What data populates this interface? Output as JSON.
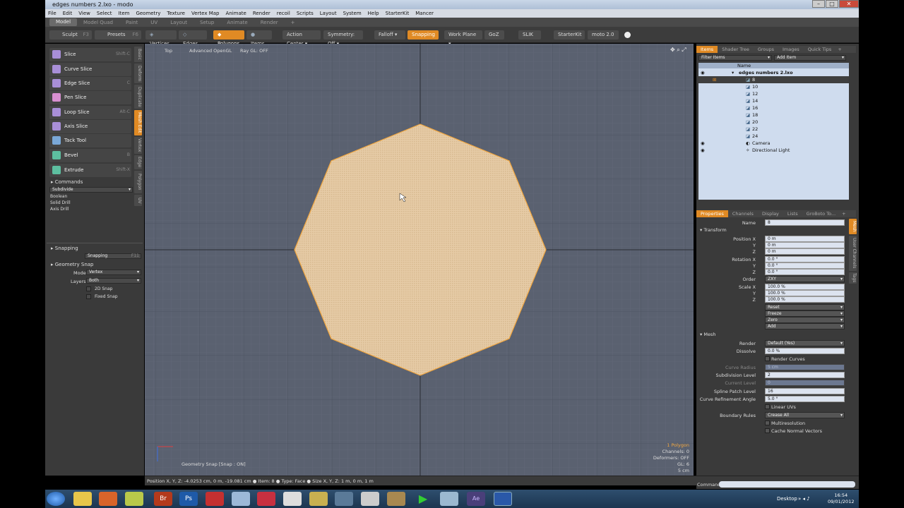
{
  "window": {
    "title": "edges numbers 2.lxo - modo"
  },
  "menu": [
    "File",
    "Edit",
    "View",
    "Select",
    "Item",
    "Geometry",
    "Texture",
    "Vertex Map",
    "Animate",
    "Render",
    "recoil",
    "Scripts",
    "Layout",
    "System",
    "Help",
    "StarterKit",
    "Mancer"
  ],
  "layout_tabs": [
    "Model",
    "Model Quad",
    "Paint",
    "UV",
    "Layout",
    "Setup",
    "Animate",
    "Render",
    "+"
  ],
  "toolbar": {
    "sculpt": "Sculpt",
    "sculpt_key": "F3",
    "presets": "Presets",
    "presets_key": "F6",
    "vertices": "Vertices",
    "edges": "Edges",
    "polygons": "Polygons",
    "items": "Items",
    "action_center": "Action Center",
    "symmetry": "Symmetry: Off",
    "falloff": "Falloff",
    "snapping": "Snapping",
    "work_plane": "Work Plane",
    "goz": "GoZ",
    "slik": "SLIK",
    "starterkit": "StarterKit",
    "moto": "moto 2.0"
  },
  "tools": [
    {
      "label": "Slice",
      "key": "Shift-C",
      "color": "#a98fd8"
    },
    {
      "label": "Curve Slice",
      "key": "",
      "color": "#a98fd8"
    },
    {
      "label": "Edge Slice",
      "key": "C",
      "color": "#a98fd8"
    },
    {
      "label": "Pen Slice",
      "key": "",
      "color": "#d88fd0"
    },
    {
      "label": "Loop Slice",
      "key": "Alt-C",
      "color": "#a98fd8"
    },
    {
      "label": "Axis Slice",
      "key": "",
      "color": "#a98fd8"
    },
    {
      "label": "Tack Tool",
      "key": "",
      "color": "#7aa8d8"
    },
    {
      "label": "Bevel",
      "key": "B",
      "color": "#5dbfa0"
    },
    {
      "label": "Extrude",
      "key": "Shift-X",
      "color": "#5dbfa0"
    }
  ],
  "vtabs": [
    "Basic",
    "Deform",
    "Duplicate",
    "Mesh Edit",
    "Vertex",
    "Edge",
    "Polygon",
    "UV"
  ],
  "commands": {
    "header": "Commands",
    "subdivide": "Subdivide",
    "boolean": "Boolean",
    "solid_drill": "Solid Drill",
    "axis_drill": "Axis Drill"
  },
  "snapping": {
    "header": "Snapping",
    "button": "Snapping",
    "key": "F11",
    "geo_header": "Geometry Snap",
    "mode_label": "Mode",
    "mode_value": "Vertex",
    "layers_label": "Layers",
    "layers_value": "Both",
    "snap2d": "2D Snap",
    "fixed": "Fixed Snap"
  },
  "viewport": {
    "view": "Top",
    "renderer": "Advanced OpenGL",
    "raygl": "Ray GL: OFF",
    "geo_snap": "Geometry Snap [Snap : ON]",
    "info": [
      "1 Polygon",
      "Channels: 0",
      "Deformers: OFF",
      "GL: 6",
      "5 cm"
    ]
  },
  "status": {
    "text": "Position X, Y, Z:  -4.0253 cm, 0 m, -19.081 cm ● Item: 8 ● Type: Face ● Size X, Y, Z:  1 m, 0 m, 1 m"
  },
  "right_tabs": [
    "Items",
    "Shader Tree",
    "Groups",
    "Images",
    "Quick Tips",
    "+"
  ],
  "items_toolbar": {
    "filter": "Filter Items",
    "add": "Add Item",
    "name_col": "Name"
  },
  "items": [
    {
      "name": "edges numbers 2.lxo",
      "kind": "scene",
      "eye": true
    },
    {
      "name": "8",
      "kind": "mesh",
      "eye": false,
      "selected": true
    },
    {
      "name": "10",
      "kind": "mesh",
      "eye": false
    },
    {
      "name": "12",
      "kind": "mesh",
      "eye": false
    },
    {
      "name": "14",
      "kind": "mesh",
      "eye": false
    },
    {
      "name": "16",
      "kind": "mesh",
      "eye": false
    },
    {
      "name": "18",
      "kind": "mesh",
      "eye": false
    },
    {
      "name": "20",
      "kind": "mesh",
      "eye": false
    },
    {
      "name": "22",
      "kind": "mesh",
      "eye": false
    },
    {
      "name": "24",
      "kind": "mesh",
      "eye": false
    },
    {
      "name": "Camera",
      "kind": "camera",
      "eye": true
    },
    {
      "name": "Directional Light",
      "kind": "light",
      "eye": true
    }
  ],
  "prop_tabs": [
    "Properties",
    "Channels",
    "Display",
    "Lists",
    "GroBoto To...",
    "+"
  ],
  "prop_vtabs": [
    "Mesh",
    "User Channels",
    "Tags"
  ],
  "props": {
    "name_label": "Name",
    "name_value": "8",
    "transform": "Transform",
    "position_label": "Position X",
    "pos": [
      "0 m",
      "0 m",
      "0 m"
    ],
    "rotation_label": "Rotation X",
    "rot": [
      "0.0 °",
      "0.0 °",
      "0.0 °"
    ],
    "order_label": "Order",
    "order_value": "ZXY",
    "scale_label": "Scale X",
    "scale": [
      "100.0 %",
      "100.0 %",
      "100.0 %"
    ],
    "axis_y": "Y",
    "axis_z": "Z",
    "reset": "Reset",
    "freeze": "Freeze",
    "zero": "Zero",
    "add": "Add",
    "mesh": "Mesh",
    "render_label": "Render",
    "render_value": "Default (Yes)",
    "dissolve_label": "Dissolve",
    "dissolve_value": "0.0 %",
    "render_curves": "Render Curves",
    "curve_radius_label": "Curve Radius",
    "curve_radius_value": "5 cm",
    "subdiv_label": "Subdivision Level",
    "subdiv_value": "2",
    "current_label": "Current Level",
    "current_value": "0",
    "spline_label": "Spline Patch Level",
    "spline_value": "16",
    "refine_label": "Curve Refinement Angle",
    "refine_value": "5.0 °",
    "linear_uvs": "Linear UVs",
    "boundary_label": "Boundary Rules",
    "boundary_value": "Crease All",
    "multires": "Multiresolution",
    "cache": "Cache Normal Vectors"
  },
  "command": {
    "label": "Command"
  },
  "taskbar": {
    "desktop": "Desktop",
    "time": "16:54",
    "date": "09/01/2012"
  }
}
